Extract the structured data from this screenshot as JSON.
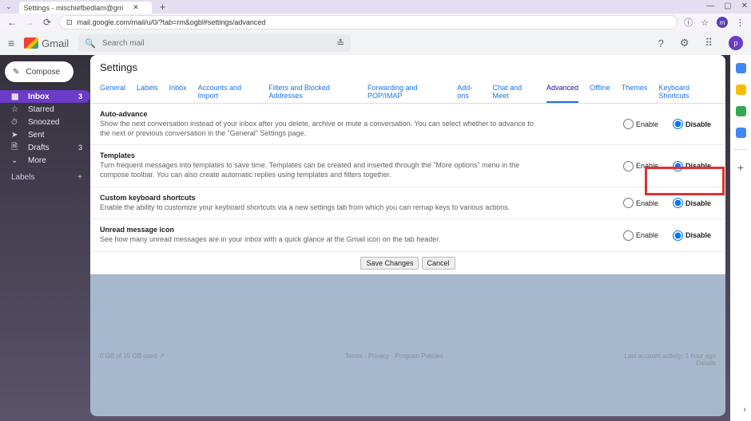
{
  "browser": {
    "tab_title": "Settings - mischiefbedlam@gm",
    "url": "mail.google.com/mail/u/0/?tab=rm&ogbl#settings/advanced",
    "win_min": "—",
    "win_max": "▢",
    "win_close": "✕",
    "tab_close": "✕",
    "tab_add": "+",
    "back": "←",
    "forward": "→",
    "reload": "⟳",
    "info_icon": "ⓘ",
    "star": "☆",
    "menu": "⋮",
    "profile": "m"
  },
  "gm_header": {
    "burger": "≡",
    "brand": "Gmail",
    "search_placeholder": "Search mail",
    "search_icon": "🔍",
    "tune": "≛",
    "help": "?",
    "gear": "⚙",
    "apps": "⠿",
    "avatar": "p"
  },
  "sidebar": {
    "compose_icon": "✎",
    "compose_label": "Compose",
    "items": [
      {
        "icon": "▦",
        "label": "Inbox",
        "count": "3",
        "sel": true
      },
      {
        "icon": "☆",
        "label": "Starred"
      },
      {
        "icon": "⏱",
        "label": "Snoozed"
      },
      {
        "icon": "➤",
        "label": "Sent"
      },
      {
        "icon": "🗎",
        "label": "Drafts",
        "count": "3"
      },
      {
        "icon": "⌄",
        "label": "More"
      }
    ],
    "labels_hdr": "Labels",
    "labels_add": "+"
  },
  "settings": {
    "title": "Settings",
    "tabs": [
      "General",
      "Labels",
      "Inbox",
      "Accounts and Import",
      "Filters and Blocked Addresses",
      "Forwarding and POP/IMAP",
      "Add-ons",
      "Chat and Meet",
      "Advanced",
      "Offline",
      "Themes",
      "Keyboard Shortcuts"
    ],
    "active_tab": "Advanced",
    "enable": "Enable",
    "disable": "Disable",
    "rows": [
      {
        "title": "Auto-advance",
        "desc": "Show the next conversation instead of your inbox after you delete, archive or mute a conversation. You can select whether to advance to the next or previous conversation in the \"General\" Settings page.",
        "value": "disable"
      },
      {
        "title": "Templates",
        "desc": "Turn frequent messages into templates to save time. Templates can be created and inserted through the \"More options\" menu in the compose toolbar. You can also create automatic replies using templates and filters together.",
        "value": "disable"
      },
      {
        "title": "Custom keyboard shortcuts",
        "desc": "Enable the ability to customize your keyboard shortcuts via a new settings tab from which you can remap keys to various actions.",
        "value": "disable"
      },
      {
        "title": "Unread message icon",
        "desc": "See how many unread messages are in your inbox with a quick glance at the Gmail icon on the tab header.",
        "value": "disable"
      }
    ],
    "save_btn": "Save Changes",
    "cancel_btn": "Cancel"
  },
  "footer": {
    "storage": "0 GB of 15 GB used",
    "storage_icon": "↗",
    "terms": "Terms",
    "privacy": "Privacy",
    "policies": "Program Policies",
    "activity": "Last account activity: 1 hour ago",
    "details": "Details"
  }
}
